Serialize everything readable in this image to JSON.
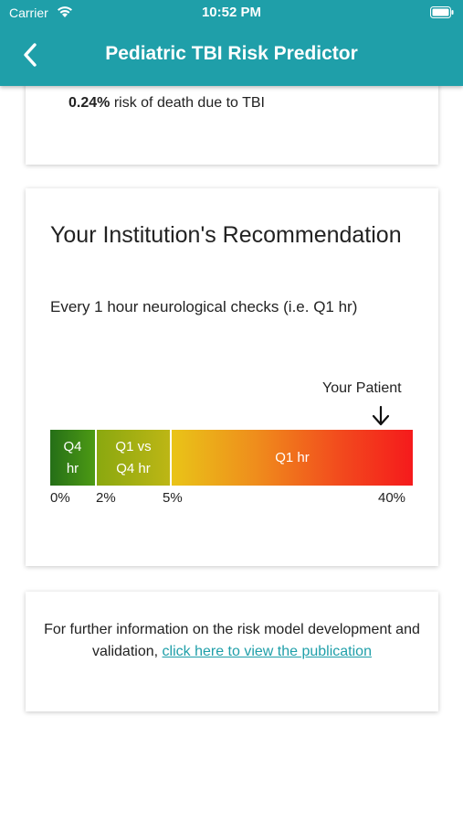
{
  "status_bar": {
    "carrier": "Carrier",
    "time": "10:52 PM",
    "icons": [
      "wifi-icon",
      "battery-icon"
    ]
  },
  "header": {
    "title": "Pediatric TBI Risk Predictor",
    "back_icon": "chevron-left-icon",
    "color": "#1f9fa9"
  },
  "top_card": {
    "risk_value": "0.24%",
    "risk_text": " risk of death due to TBI"
  },
  "recommendation": {
    "title": "Your Institution's Recommendation",
    "text": "Every 1 hour neurological checks (i.e. Q1 hr)",
    "patient_label": "Your Patient",
    "segments": [
      {
        "line1": "Q4",
        "line2": "hr",
        "color": "#2f7d14"
      },
      {
        "line1": "Q1 vs",
        "line2": "Q4 hr",
        "color": "#a3ae13"
      },
      {
        "line1": "Q1 hr",
        "line2": "",
        "color": "#f24a1d"
      }
    ],
    "ticks": [
      "0%",
      "2%",
      "5%",
      "40%"
    ]
  },
  "info": {
    "text": "For further information on the risk model development and validation, ",
    "link": "click here to view the publication",
    "link_color": "#1f9fa9"
  }
}
